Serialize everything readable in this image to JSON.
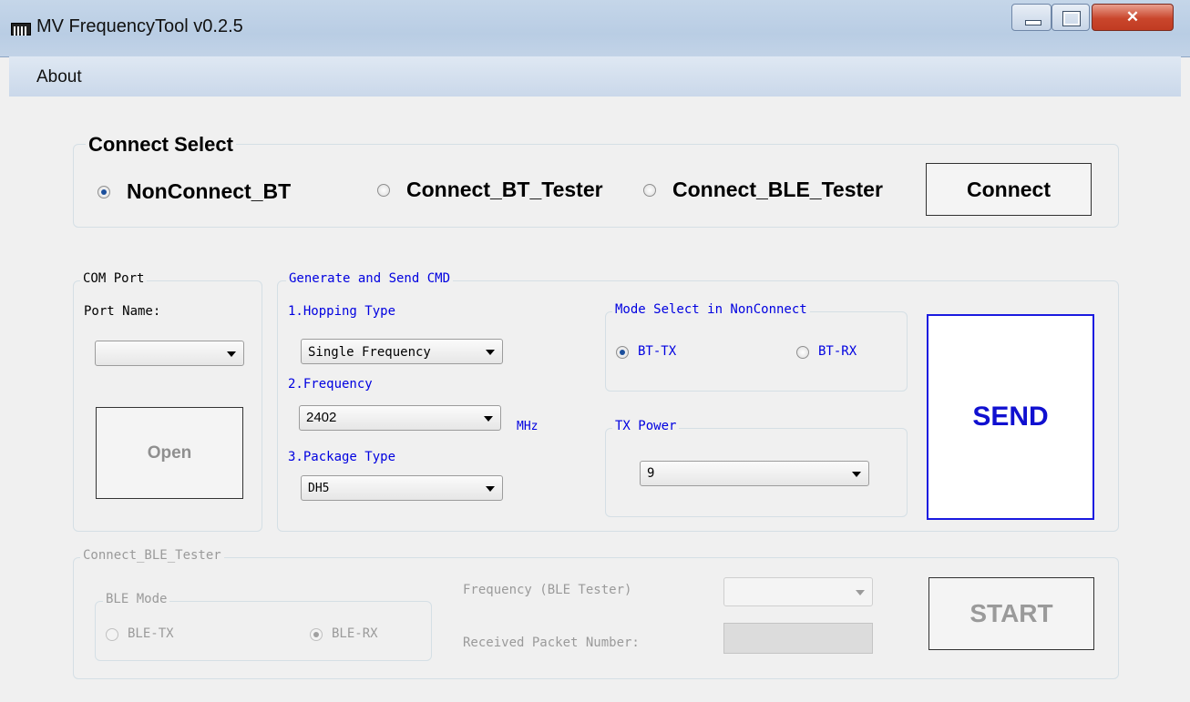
{
  "window": {
    "title": "MV FrequencyTool v0.2.5"
  },
  "menu": {
    "about": "About"
  },
  "connect_select": {
    "title": "Connect Select",
    "options": [
      "NonConnect_BT",
      "Connect_BT_Tester",
      "Connect_BLE_Tester"
    ],
    "selected": "NonConnect_BT",
    "connect_button": "Connect"
  },
  "com_port": {
    "legend": "COM Port",
    "port_name_label": "Port Name:",
    "port_name_value": "",
    "open_button": "Open"
  },
  "generate": {
    "legend": "Generate and Send CMD",
    "hopping_label": "1.Hopping Type",
    "hopping_value": "Single Frequency",
    "frequency_label": "2.Frequency",
    "frequency_value": "2402",
    "frequency_unit": "MHz",
    "package_label": "3.Package Type",
    "package_value": "DH5"
  },
  "mode_select": {
    "legend": "Mode Select in NonConnect",
    "options": [
      "BT-TX",
      "BT-RX"
    ],
    "selected": "BT-TX"
  },
  "tx_power": {
    "legend": "TX Power",
    "value": "9"
  },
  "send_button": "SEND",
  "ble_tester": {
    "legend": "Connect_BLE_Tester",
    "ble_mode_legend": "BLE Mode",
    "ble_mode_options": [
      "BLE-TX",
      "BLE-RX"
    ],
    "ble_mode_selected": "BLE-RX",
    "frequency_label": "Frequency (BLE Tester)",
    "frequency_value": "",
    "received_label": "Received Packet Number:",
    "received_value": "",
    "start_button": "START"
  },
  "colors": {
    "accent_blue": "#0000e0",
    "send_border": "#1a1ae0",
    "disabled_text": "#9a9a9a"
  }
}
